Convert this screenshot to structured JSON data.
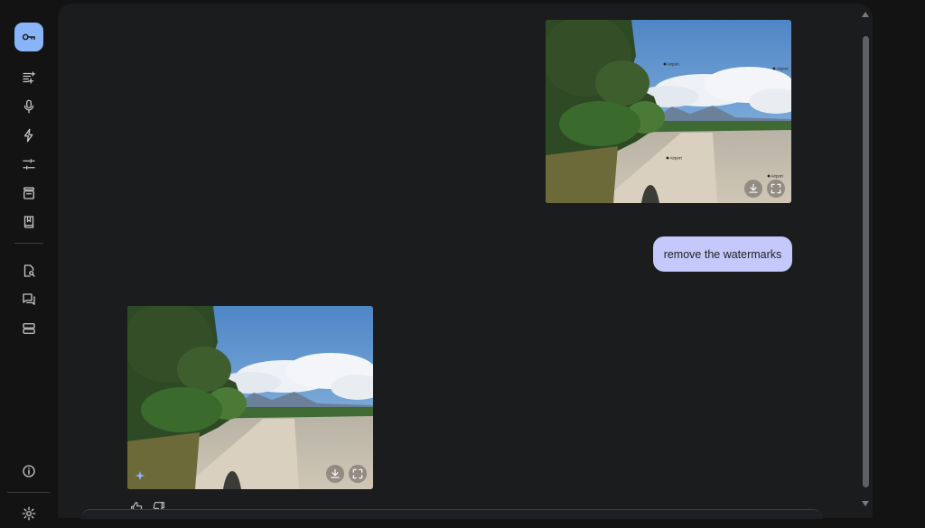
{
  "app": {
    "colors": {
      "background": "#131314",
      "panel": "#1b1c1d",
      "accent": "#8ab4f8",
      "user_bubble": "#c4c8fb",
      "icon": "#c4c7c5"
    }
  },
  "sidebar": {
    "items": [
      {
        "icon": "key-icon",
        "active": true
      },
      {
        "icon": "new-prompt-icon"
      },
      {
        "icon": "microphone-icon"
      },
      {
        "icon": "bolt-icon"
      },
      {
        "icon": "tune-icon"
      },
      {
        "icon": "archive-icon"
      },
      {
        "icon": "book-icon"
      },
      {
        "icon": "document-search-icon"
      },
      {
        "icon": "chat-icon"
      },
      {
        "icon": "storage-icon"
      },
      {
        "icon": "info-icon"
      },
      {
        "icon": "settings-icon"
      }
    ]
  },
  "chat": {
    "user_message": "remove the watermarks",
    "input_image": {
      "has_watermarks": true,
      "watermark_text": "Airport"
    },
    "output_image": {
      "has_watermarks": false
    },
    "image_actions": [
      "download-icon",
      "fullscreen-icon"
    ],
    "response_actions": [
      "thumbs-up-icon",
      "thumbs-down-icon"
    ]
  }
}
